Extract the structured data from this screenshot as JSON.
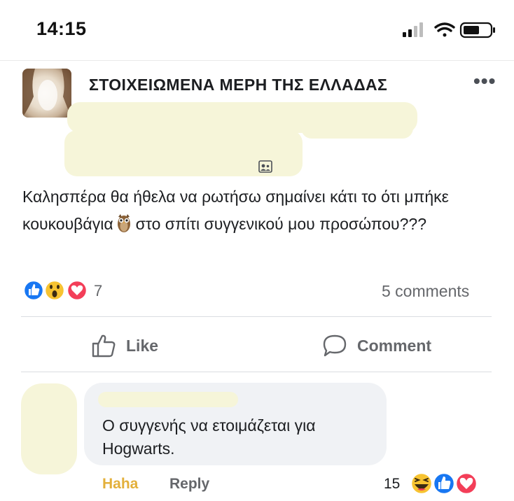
{
  "status_bar": {
    "time": "14:15",
    "icons": [
      "cellular-signal-icon",
      "wifi-icon",
      "battery-icon"
    ]
  },
  "post": {
    "group_name": "ΣΤΟΙΧΕΙΩΜΕΝΑ ΜΕΡΗ ΤΗΣ ΕΛΛΑΔΑΣ",
    "more_icon": "more-dots-icon",
    "text_before_emoji": "Καλησπέρα θα ήθελα να ρωτήσω σημαίνει κάτι το ότι μπήκε κουκουβάγια",
    "text_after_emoji": "στο σπίτι συγγενικού μου προσώπου???",
    "inline_emoji": "owl-emoji",
    "reaction_icons": [
      "like-reaction-icon",
      "wow-reaction-icon",
      "love-reaction-icon"
    ],
    "reaction_count": "7",
    "comments_count": "5 comments"
  },
  "actions": {
    "like_label": "Like",
    "comment_label": "Comment"
  },
  "comment": {
    "text": "Ο συγγενής να ετοιμάζεται για Hogwarts.",
    "haha_label": "Haha",
    "reply_label": "Reply",
    "reaction_count": "15",
    "reaction_icons": [
      "haha-reaction-icon",
      "like-reaction-icon",
      "love-reaction-icon"
    ]
  },
  "colors": {
    "facebook_blue": "#1877f2",
    "love_red": "#f33e58",
    "haha_yellow": "#f7b125",
    "secondary_text": "#65676b",
    "redaction": "#f6f5d9"
  }
}
